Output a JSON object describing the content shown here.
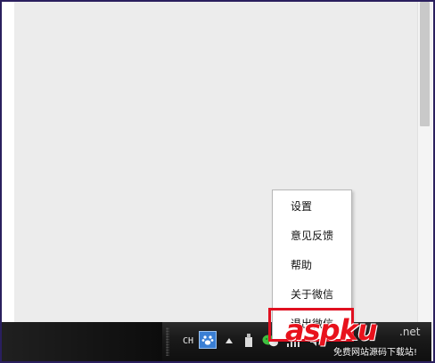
{
  "context_menu": {
    "items": [
      {
        "label": "设置"
      },
      {
        "label": "意见反馈"
      },
      {
        "label": "帮助"
      },
      {
        "label": "关于微信"
      },
      {
        "label": "退出微信"
      }
    ]
  },
  "taskbar": {
    "language_indicator": "CH",
    "tray_icons": [
      "baidu-paw-icon",
      "show-hidden-icons-arrow",
      "usb-clip-icon",
      "wechat-icon",
      "network-signal-icon",
      "speaker-icon"
    ]
  },
  "watermark": {
    "logo": "aspku",
    "suffix": ".net",
    "tagline": "免费网站源码下载站!"
  },
  "colors": {
    "content_bg": "#ececec",
    "taskbar_bg": "#1a1a1a",
    "highlight": "#e01020",
    "watermark_red": "#e8121c"
  }
}
